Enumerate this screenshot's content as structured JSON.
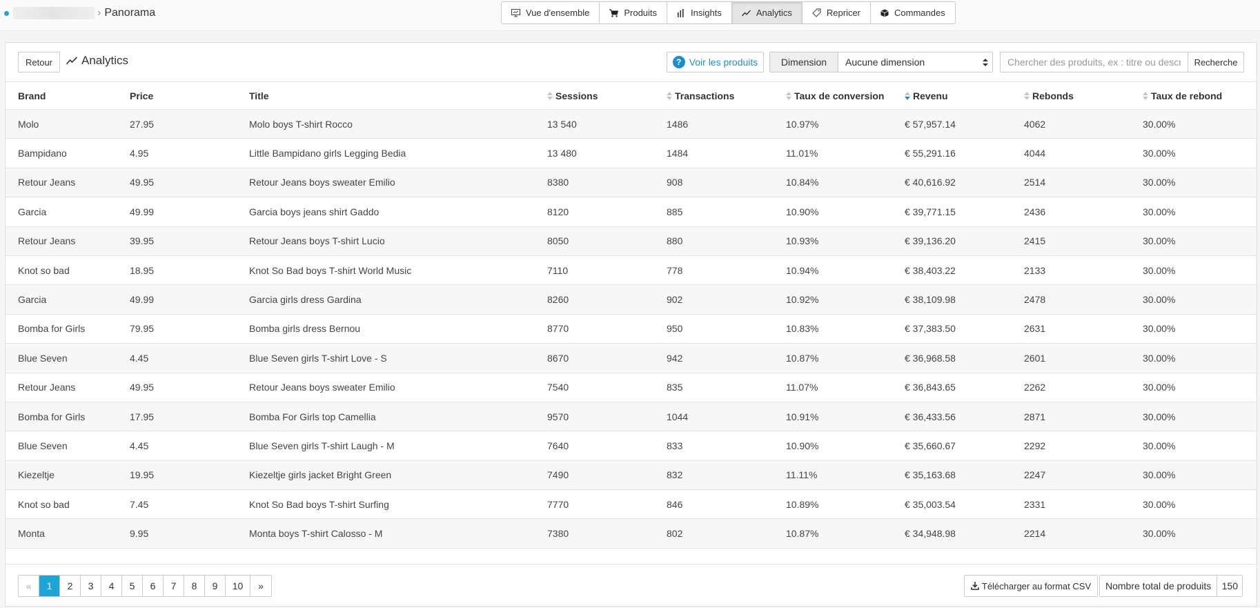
{
  "breadcrumb": {
    "current": "Panorama"
  },
  "nav": {
    "tabs": [
      {
        "label": "Vue d'ensemble",
        "icon": "monitor-icon",
        "active": false
      },
      {
        "label": "Produits",
        "icon": "cart-icon",
        "active": false
      },
      {
        "label": "Insights",
        "icon": "bar-chart-icon",
        "active": false
      },
      {
        "label": "Analytics",
        "icon": "line-chart-icon",
        "active": true
      },
      {
        "label": "Repricer",
        "icon": "tag-icon",
        "active": false
      },
      {
        "label": "Commandes",
        "icon": "box-icon",
        "active": false
      }
    ]
  },
  "panel": {
    "back_label": "Retour",
    "title": "Analytics",
    "view_products_label": "Voir les produits",
    "dimension_label": "Dimension",
    "dimension_value": "Aucune dimension",
    "search_placeholder": "Chercher des produits, ex : titre ou description",
    "search_button": "Recherche"
  },
  "table": {
    "columns": [
      {
        "label": "Brand",
        "sortable": false
      },
      {
        "label": "Price",
        "sortable": false
      },
      {
        "label": "Title",
        "sortable": false
      },
      {
        "label": "Sessions",
        "sortable": true
      },
      {
        "label": "Transactions",
        "sortable": true
      },
      {
        "label": "Taux de conversion",
        "sortable": true
      },
      {
        "label": "Revenu",
        "sortable": true,
        "sorted": "desc"
      },
      {
        "label": "Rebonds",
        "sortable": true
      },
      {
        "label": "Taux de rebond",
        "sortable": true
      }
    ],
    "rows": [
      [
        "Molo",
        "27.95",
        "Molo boys T-shirt Rocco",
        "13 540",
        "1486",
        "10.97%",
        "€ 57,957.14",
        "4062",
        "30.00%"
      ],
      [
        "Bampidano",
        "4.95",
        "Little Bampidano girls Legging Bedia",
        "13 480",
        "1484",
        "11.01%",
        "€ 55,291.16",
        "4044",
        "30.00%"
      ],
      [
        "Retour Jeans",
        "49.95",
        "Retour Jeans boys sweater Emilio",
        "8380",
        "908",
        "10.84%",
        "€ 40,616.92",
        "2514",
        "30.00%"
      ],
      [
        "Garcia",
        "49.99",
        "Garcia boys jeans shirt Gaddo",
        "8120",
        "885",
        "10.90%",
        "€ 39,771.15",
        "2436",
        "30.00%"
      ],
      [
        "Retour Jeans",
        "39.95",
        "Retour Jeans boys T-shirt Lucio",
        "8050",
        "880",
        "10.93%",
        "€ 39,136.20",
        "2415",
        "30.00%"
      ],
      [
        "Knot so bad",
        "18.95",
        "Knot So Bad boys T-shirt World Music",
        "7110",
        "778",
        "10.94%",
        "€ 38,403.22",
        "2133",
        "30.00%"
      ],
      [
        "Garcia",
        "49.99",
        "Garcia girls dress Gardina",
        "8260",
        "902",
        "10.92%",
        "€ 38,109.98",
        "2478",
        "30.00%"
      ],
      [
        "Bomba for Girls",
        "79.95",
        "Bomba girls dress Bernou",
        "8770",
        "950",
        "10.83%",
        "€ 37,383.50",
        "2631",
        "30.00%"
      ],
      [
        "Blue Seven",
        "4.45",
        "Blue Seven girls T-shirt Love - S",
        "8670",
        "942",
        "10.87%",
        "€ 36,968.58",
        "2601",
        "30.00%"
      ],
      [
        "Retour Jeans",
        "49.95",
        "Retour Jeans boys sweater Emilio",
        "7540",
        "835",
        "11.07%",
        "€ 36,843.65",
        "2262",
        "30.00%"
      ],
      [
        "Bomba for Girls",
        "17.95",
        "Bomba For Girls top Camellia",
        "9570",
        "1044",
        "10.91%",
        "€ 36,433.56",
        "2871",
        "30.00%"
      ],
      [
        "Blue Seven",
        "4.45",
        "Blue Seven girls T-shirt Laugh - M",
        "7640",
        "833",
        "10.90%",
        "€ 35,660.67",
        "2292",
        "30.00%"
      ],
      [
        "Kiezeltje",
        "19.95",
        "Kiezeltje girls jacket Bright Green",
        "7490",
        "832",
        "11.11%",
        "€ 35,163.68",
        "2247",
        "30.00%"
      ],
      [
        "Knot so bad",
        "7.45",
        "Knot So Bad boys T-shirt Surfing",
        "7770",
        "846",
        "10.89%",
        "€ 35,003.54",
        "2331",
        "30.00%"
      ],
      [
        "Monta",
        "9.95",
        "Monta boys T-shirt Calosso - M",
        "7380",
        "802",
        "10.87%",
        "€ 34,948.98",
        "2214",
        "30.00%"
      ]
    ]
  },
  "pagination": {
    "prev": "«",
    "next": "»",
    "pages": [
      "1",
      "2",
      "3",
      "4",
      "5",
      "6",
      "7",
      "8",
      "9",
      "10"
    ],
    "current": "1"
  },
  "footer": {
    "csv_label": "Télécharger au format CSV",
    "total_label": "Nombre total de produits",
    "total_value": "150"
  },
  "colors": {
    "accent": "#1ea5d8",
    "link": "#1a8fd0"
  }
}
